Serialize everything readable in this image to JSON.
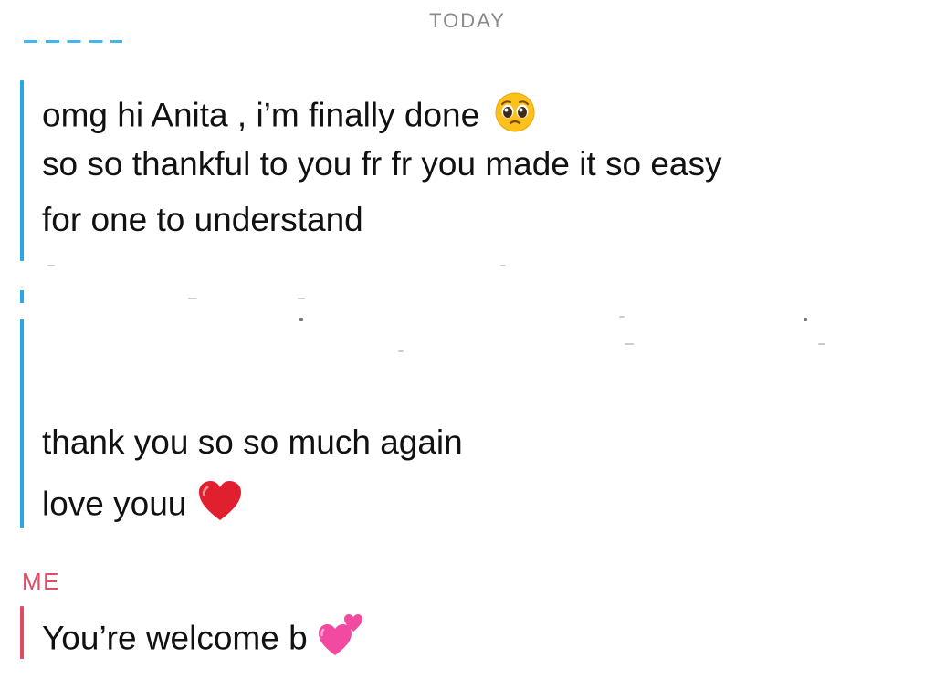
{
  "header": {
    "day_label": "TODAY"
  },
  "friend_messages": [
    {
      "text": "omg hi Anita , i’m finally done",
      "emoji": "pleading-face-emoji"
    },
    {
      "text": "so so thankful to you fr fr you made it so easy"
    },
    {
      "text": "for one to understand"
    },
    {
      "text": "thank you so so much again"
    },
    {
      "text": "love youu",
      "emoji": "red-heart-emoji"
    }
  ],
  "me": {
    "sender_label": "ME",
    "message": {
      "text": "You’re welcome b",
      "emoji": "two-hearts-emoji"
    }
  },
  "colors": {
    "friend_accent": "#27a6e5",
    "me_accent": "#e14b65",
    "day_label": "#8a8a8a",
    "text": "#111111"
  }
}
